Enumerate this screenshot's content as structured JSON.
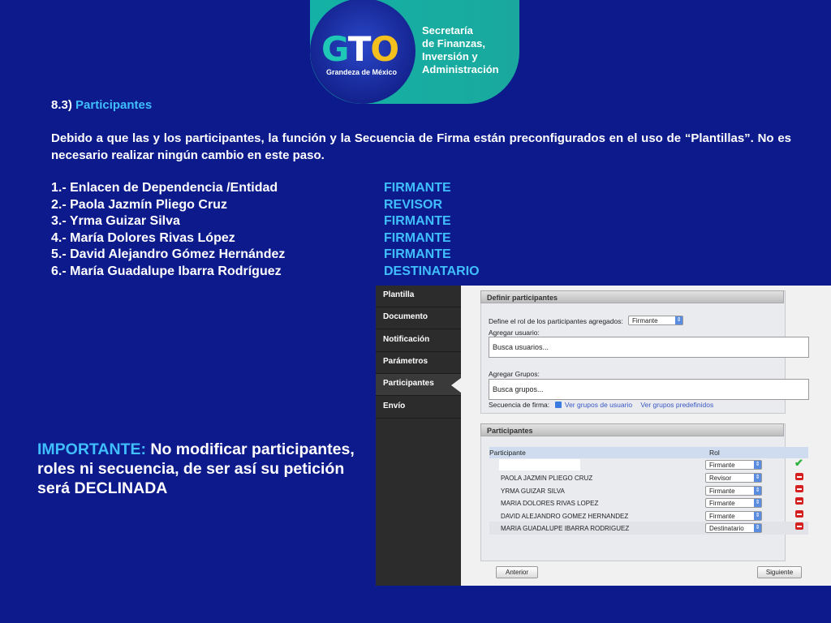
{
  "logo": {
    "letters": [
      "G",
      "T",
      "O"
    ],
    "tagline": "Grandeza de México",
    "org_lines": [
      "Secretaría",
      "de Finanzas,",
      "Inversión y",
      "Administración"
    ]
  },
  "section": {
    "number": "8.3)",
    "title": "Participantes"
  },
  "paragraph": "Debido a que las y los participantes, la función y la Secuencia de Firma están preconfigurados en el uso de “Plantillas”. No es necesario realizar ningún cambio en este paso.",
  "participants_list": [
    {
      "name": "1.- Enlacen de Dependencia /Entidad",
      "role": "FIRMANTE"
    },
    {
      "name": "2.- Paola Jazmín Pliego Cruz",
      "role": "REVISOR"
    },
    {
      "name": "3.- Yrma Guizar Silva",
      "role": "FIRMANTE"
    },
    {
      "name": "4.- María Dolores Rivas López",
      "role": "FIRMANTE"
    },
    {
      "name": "5.- David Alejandro Gómez Hernández",
      "role": "FIRMANTE"
    },
    {
      "name": "6.- María Guadalupe Ibarra Rodríguez",
      "role": "DESTINATARIO"
    }
  ],
  "important": {
    "key": "IMPORTANTE:",
    "text": " No modificar participantes, roles ni secuencia, de ser así su petición será DECLINADA"
  },
  "app": {
    "sidebar": [
      "Plantilla",
      "Documento",
      "Notificación",
      "Parámetros",
      "Participantes",
      "Envío"
    ],
    "define_title": "Definir participantes",
    "role_label": "Define el rol de los participantes agregados:",
    "role_value": "Firmante",
    "add_user_label": "Agregar usuario:",
    "add_user_placeholder": "Busca usuarios...",
    "add_group_label": "Agregar Grupos:",
    "add_group_placeholder": "Busca grupos...",
    "sequence_label": "Secuencia de firma:",
    "view_user_groups": "Ver grupos de usuario",
    "view_predefined_groups": "Ver grupos predefinidos",
    "participants_title": "Participantes",
    "col_participant": "Participante",
    "col_role": "Rol",
    "first_row_role": "Firmante",
    "rows": [
      {
        "name": "PAOLA JAZMIN PLIEGO CRUZ",
        "role": "Revisor"
      },
      {
        "name": "YRMA GUIZAR SILVA",
        "role": "Firmante"
      },
      {
        "name": "MARIA DOLORES RIVAS LOPEZ",
        "role": "Firmante"
      },
      {
        "name": "DAVID ALEJANDRO GOMEZ HERNANDEZ",
        "role": "Firmante"
      },
      {
        "name": "MARIA GUADALUPE IBARRA RODRIGUEZ",
        "role": "Destinatario"
      }
    ],
    "prev_button": "Anterior",
    "next_button": "Siguiente"
  }
}
